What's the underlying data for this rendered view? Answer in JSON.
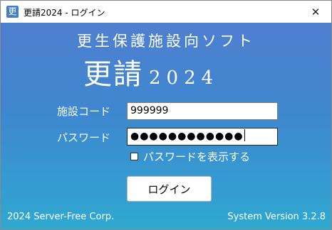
{
  "window": {
    "title": "更請2024 - ログイン",
    "app_icon_char": "更",
    "close_glyph": "✕"
  },
  "header": {
    "subtitle": "更生保護施設向ソフト",
    "title_kanji": "更請",
    "title_year": "2024"
  },
  "form": {
    "facility_code_label": "施設コード",
    "facility_code_value": "999999",
    "password_label": "パスワード",
    "password_masked": "●●●●●●●●●●●●",
    "show_password_label": "パスワードを表示する",
    "show_password_checked": false,
    "login_button": "ログイン"
  },
  "footer": {
    "copyright": "2024 Server-Free Corp.",
    "version": "System Version 3.2.8"
  },
  "colors": {
    "gradient_top": "#4f7fd0",
    "gradient_bottom": "#2fa8d0",
    "app_icon": "#3f7fc6"
  },
  "icons": {
    "app": "app-logo-icon",
    "close": "close-icon"
  }
}
